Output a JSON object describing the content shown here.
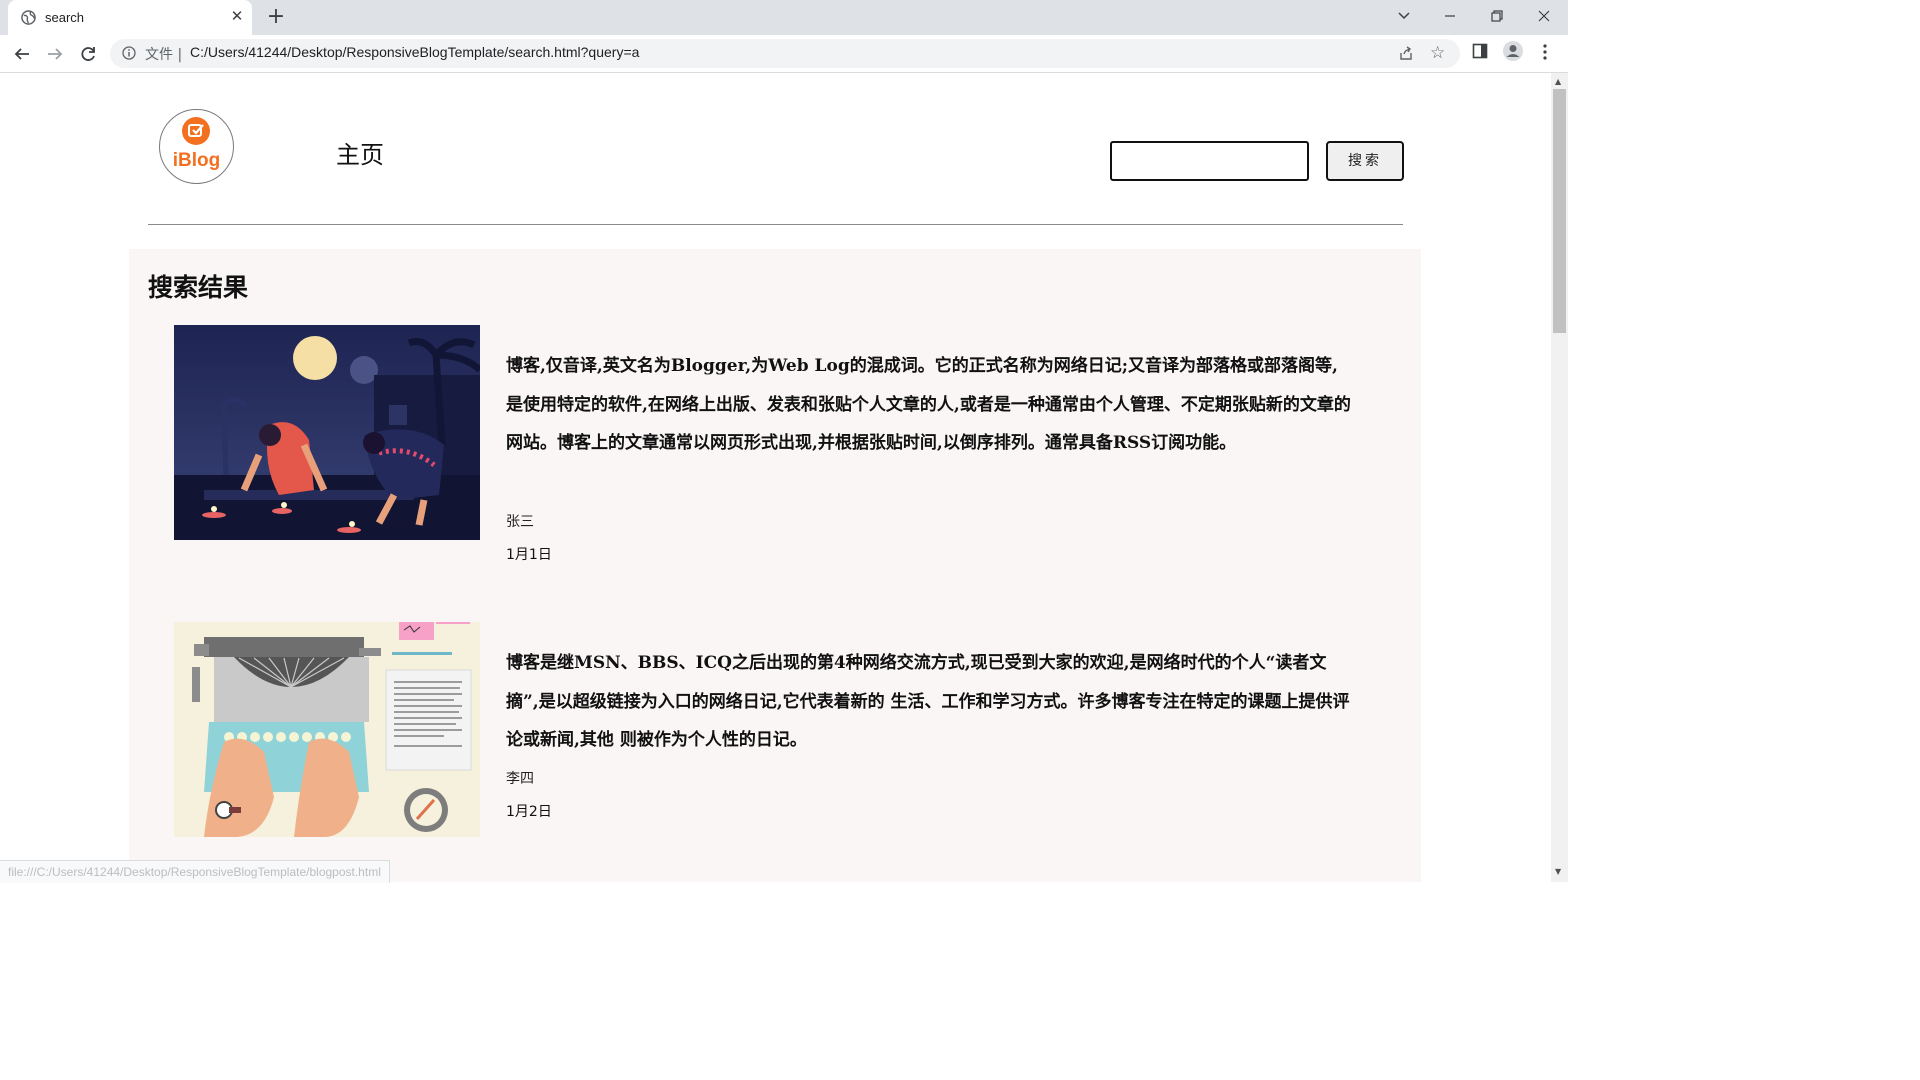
{
  "browser": {
    "tab_title": "search",
    "tab_close": "✕",
    "new_tab": "+",
    "scheme_label": "文件",
    "url": "C:/Users/41244/Desktop/ResponsiveBlogTemplate/search.html?query=a",
    "status_url": "file:///C:/Users/41244/Desktop/ResponsiveBlogTemplate/blogpost.html"
  },
  "header": {
    "logo_text": "iBlog",
    "nav_home": "主页",
    "search_value": "",
    "search_button": "搜索"
  },
  "results": {
    "heading": "搜索结果",
    "posts": [
      {
        "excerpt": "博客,仅音译,英文名为Blogger,为Web Log的混成词。它的正式名称为网络日记;又音译为部落格或部落阁等,是使用特定的软件,在网络上出版、发表和张贴个人文章的人,或者是一种通常由个人管理、不定期张贴新的文章的网站。博客上的文章通常以网页形式出现,并根据张贴时间,以倒序排列。通常具备RSS订阅功能。",
        "author": "张三",
        "date": "1月1日",
        "image_icon": "diwali-lamps-illustration"
      },
      {
        "excerpt": "博客是继MSN、BBS、ICQ之后出现的第4种网络交流方式,现已受到大家的欢迎,是网络时代的个人“读者文摘”,是以超级链接为入口的网络日记,它代表着新的 生活、工作和学习方式。许多博客专注在特定的课题上提供评论或新闻,其他 则被作为个人性的日记。",
        "author": "李四",
        "date": "1月2日",
        "image_icon": "typewriter-illustration"
      }
    ]
  },
  "colors": {
    "brand": "#f37021",
    "results_bg": "#faf6f5"
  }
}
